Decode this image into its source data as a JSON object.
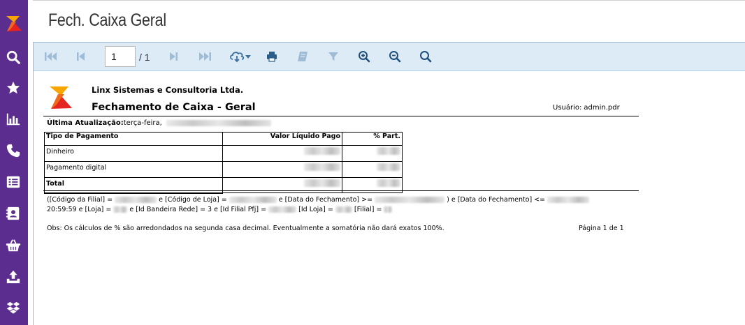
{
  "app": {
    "title": "Fech. Caixa Geral"
  },
  "sidebar": {
    "logo": "linx-logo",
    "items": [
      {
        "icon": "search-icon"
      },
      {
        "icon": "star-icon"
      },
      {
        "icon": "bar-chart-icon"
      },
      {
        "icon": "phone-icon"
      },
      {
        "icon": "list-icon"
      },
      {
        "icon": "contact-card-icon"
      },
      {
        "icon": "basket-icon"
      },
      {
        "icon": "upload-icon"
      },
      {
        "icon": "dropbox-icon"
      }
    ]
  },
  "toolbar": {
    "page_current": "1",
    "page_total": "/ 1",
    "buttons": [
      "first-page-icon",
      "prev-page-icon",
      "next-page-icon",
      "last-page-icon",
      "export-icon",
      "print-icon",
      "book-icon",
      "filter-icon",
      "zoom-in-icon",
      "zoom-out-icon",
      "search-icon"
    ]
  },
  "report": {
    "company": "Linx Sistemas e Consultoria Ltda.",
    "title": "Fechamento de Caixa - Geral",
    "user_label": "Usuário:",
    "user_value": "admin.pdr",
    "updated_label": "Última Atualização:",
    "updated_value": "terça-feira,",
    "table": {
      "headers": [
        "Tipo de Pagamento",
        "Valor Líquido Pago",
        "% Part."
      ],
      "rows": [
        {
          "label": "Dinheiro"
        },
        {
          "label": "Pagamento digital"
        }
      ],
      "total_label": "Total"
    },
    "filter": {
      "p1": "([Código da Filial] =",
      "p2": "e [Código de Loja] =",
      "p3": "e [Data do Fechamento] >=",
      "p4": ") e [Data do Fechamento] <=",
      "p5": "20:59:59 e [Loja] =",
      "p6": "e [Id Bandeira Rede] = 3 e [Id Filial Pfj] =",
      "p7": "[Id Loja] =",
      "p8": "[Filial] ="
    },
    "obs": "Obs: Os cálculos de % são arredondados na segunda casa decimal. Eventualmente a somatória não dará exatos 100%.",
    "page_label": "Página 1 de 1"
  },
  "colors": {
    "sidebar": "#5b2d8e",
    "toolbar": "#dcebf5",
    "toolbar_icon": "#3b6f9e",
    "brand_red": "#e52421",
    "brand_orange": "#f7a600"
  }
}
